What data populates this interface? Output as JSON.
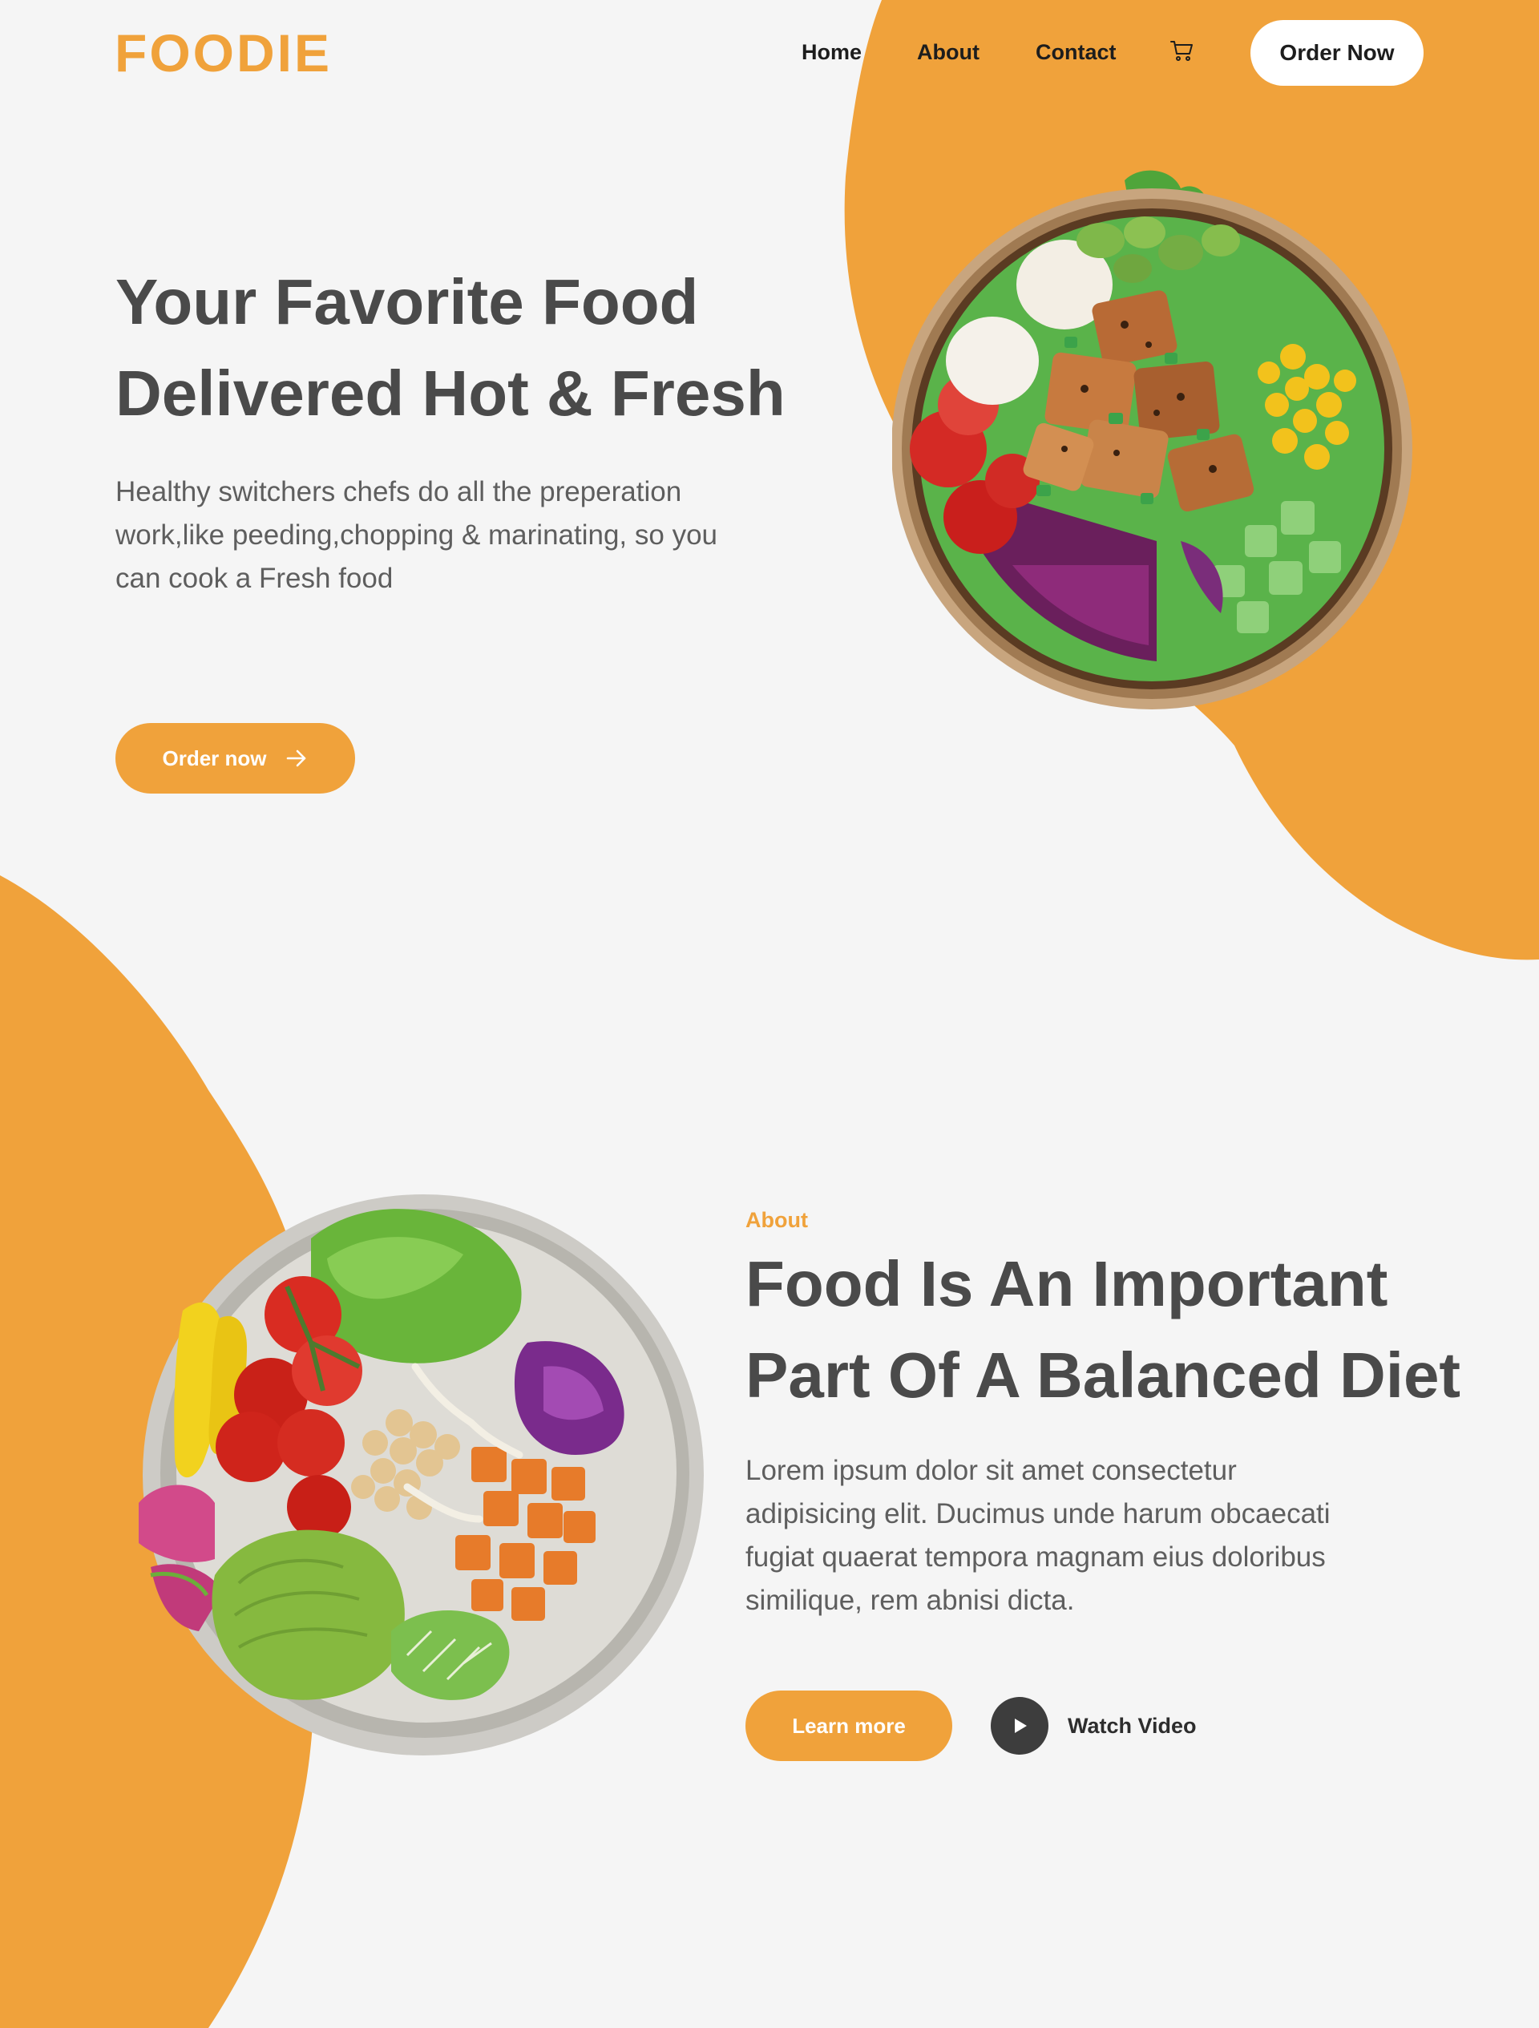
{
  "brand": {
    "logo": "FOODIE",
    "accent_color": "#f0a23b",
    "background_color": "#f5f5f5"
  },
  "nav": {
    "links": [
      "Home",
      "About",
      "Contact"
    ],
    "cart_icon": "cart-icon",
    "order_button": "Order Now"
  },
  "hero": {
    "title_line1": "Your Favorite Food",
    "title_line2": "Delivered Hot & Fresh",
    "description": "Healthy switchers chefs do all the preperation work,like peeding,chopping & marinating, so you can cook a Fresh food",
    "cta_label": "Order now",
    "cta_icon": "arrow-right-icon"
  },
  "about": {
    "label": "About",
    "title_line1": "Food Is An Important",
    "title_line2": "Part Of A Balanced Diet",
    "description": "Lorem ipsum dolor sit amet consectetur adipisicing elit. Ducimus unde harum obcaecati fugiat quaerat tempora magnam eius doloribus similique, rem abnisi dicta.",
    "learn_more_label": "Learn more",
    "watch_video_label": "Watch Video",
    "play_icon": "play-icon"
  }
}
